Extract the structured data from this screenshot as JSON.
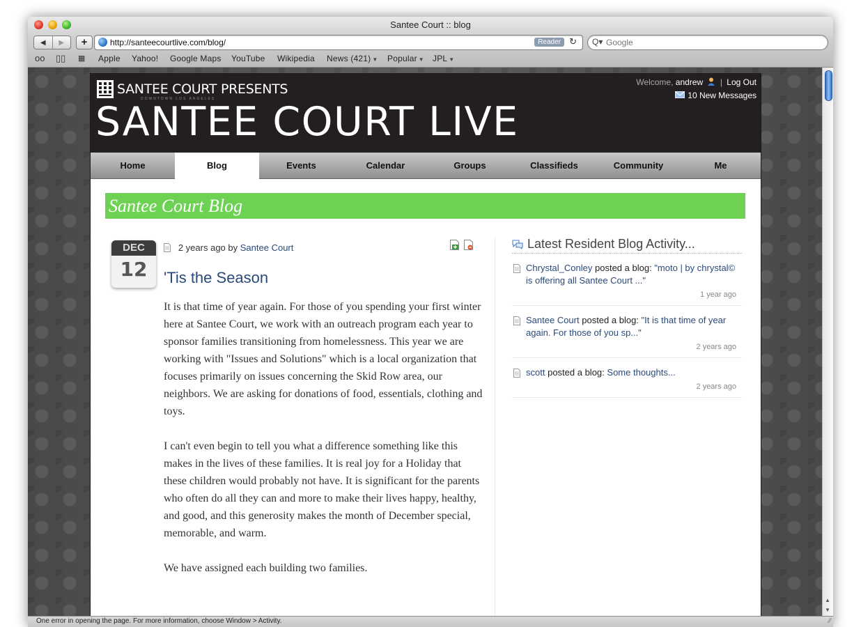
{
  "browser": {
    "title": "Santee Court :: blog",
    "url": "http://santeecourtlive.com/blog/",
    "reader_label": "Reader",
    "search_placeholder": "Google",
    "bookmarks": [
      {
        "label": "Apple"
      },
      {
        "label": "Yahoo!"
      },
      {
        "label": "Google Maps"
      },
      {
        "label": "YouTube"
      },
      {
        "label": "Wikipedia"
      },
      {
        "label": "News (421)"
      },
      {
        "label": "Popular"
      },
      {
        "label": "JPL"
      }
    ],
    "status_text": "One error in opening the page. For more information, choose Window > Activity."
  },
  "site": {
    "presents": "SANTEE COURT PRESENTS",
    "logo_sub": "DOWNTOWN LOS ANGELES",
    "title": "SANTEE COURT LIVE",
    "welcome_prefix": "Welcome,",
    "username": "andrew",
    "logout": "Log Out",
    "messages": "10 New Messages",
    "nav": [
      {
        "label": "Home"
      },
      {
        "label": "Blog"
      },
      {
        "label": "Events"
      },
      {
        "label": "Calendar"
      },
      {
        "label": "Groups"
      },
      {
        "label": "Classifieds"
      },
      {
        "label": "Community"
      },
      {
        "label": "Me"
      }
    ],
    "active_nav": "Blog",
    "banner": "Santee Court Blog"
  },
  "post": {
    "month": "DEC",
    "day": "12",
    "age": "2 years ago",
    "by": "by",
    "author": "Santee Court",
    "title": "'Tis the Season",
    "paragraphs": [
      "It is that time of year again. For those of you spending your first winter here at Santee Court, we work with an outreach program each year to sponsor families transitioning from homelessness. This year we are working with \"Issues and Solutions\" which is a local organization that focuses primarily on issues concerning the Skid Row area, our neighbors. We are asking for donations of food, essentials, clothing and toys.",
      "I can't even begin to tell you what a difference something like this makes in the lives of these families. It is real joy for a Holiday that these children would probably not have. It is significant for the parents who often do all they can and more to make their lives happy, healthy, and good, and this generosity makes the month of December special, memorable, and warm.",
      "We have assigned each building two families."
    ]
  },
  "sidebar": {
    "heading": "Latest Resident Blog Activity...",
    "activity": [
      {
        "user": "Chrystal_Conley",
        "action": "posted a blog:",
        "link": "\"moto | by chrystal© is offering all Santee Court ...\"",
        "time": "1 year ago"
      },
      {
        "user": "Santee Court",
        "action": "posted a blog:",
        "link": "\"It is that time of year again. For those of you sp...\"",
        "time": "2 years ago"
      },
      {
        "user": "scott",
        "action": "posted a blog:",
        "link": "Some thoughts...",
        "time": "2 years ago"
      }
    ]
  },
  "colors": {
    "banner_green": "#6dd254",
    "header_black": "#231f20",
    "link_blue": "#2a4a7a"
  }
}
